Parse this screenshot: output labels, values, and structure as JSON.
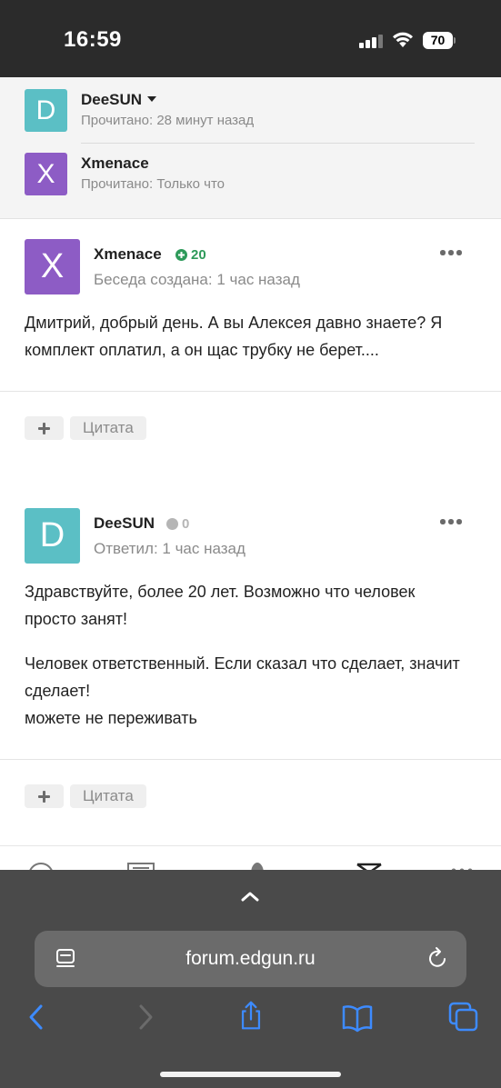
{
  "status_bar": {
    "time": "16:59",
    "battery": "70"
  },
  "participants": [
    {
      "initial": "D",
      "name": "DeeSUN",
      "read": "Прочитано: 28 минут назад",
      "avatar_color": "#5bbfc5"
    },
    {
      "initial": "X",
      "name": "Xmenace",
      "read": "Прочитано: Только что",
      "avatar_color": "#8d5cc5"
    }
  ],
  "posts": [
    {
      "initial": "X",
      "author": "Xmenace",
      "reputation": "20",
      "reputation_color": "#2e9a5a",
      "meta": "Беседа создана: 1 час назад",
      "avatar_color": "#8d5cc5",
      "paragraphs": [
        "Дмитрий, добрый день. А вы Алексея давно знаете? Я комплект оплатил, а он щас трубку не берет...."
      ],
      "quote_label": "Цитата"
    },
    {
      "initial": "D",
      "author": "DeeSUN",
      "reputation": "0",
      "reputation_color": "#b5b5b5",
      "meta": "Ответил: 1 час назад",
      "avatar_color": "#5bbfc5",
      "paragraphs": [
        "Здравствуйте, более 20 лет. Возможно что человек просто занят!",
        "Человек ответственный. Если сказал что сделает, значит сделает!",
        "можете не переживать"
      ],
      "quote_label": "Цитата"
    }
  ],
  "browser": {
    "url": "forum.edgun.ru",
    "accent_color": "#3d8bff"
  }
}
